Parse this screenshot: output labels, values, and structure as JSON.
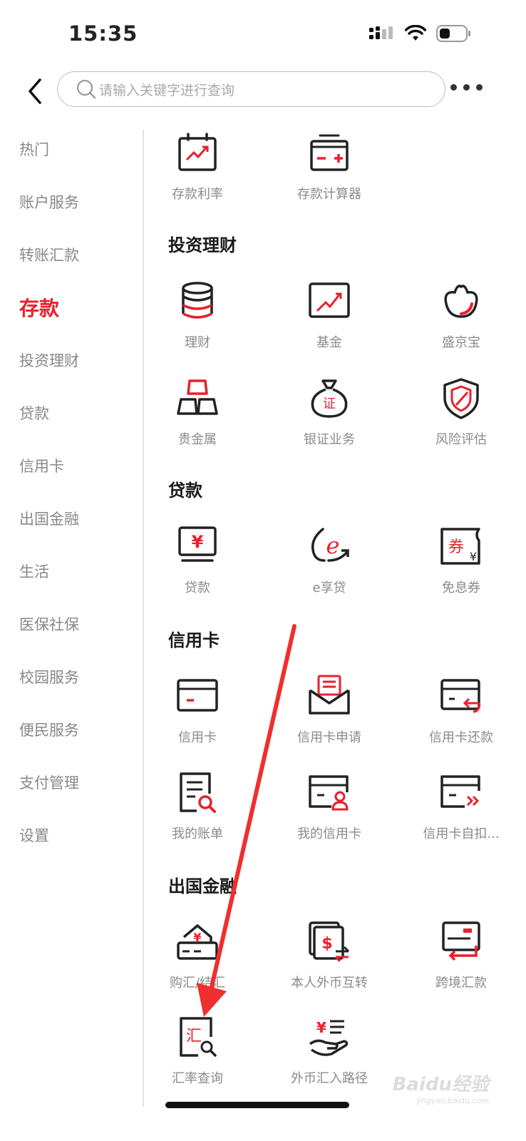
{
  "status": {
    "time": "15:35"
  },
  "search": {
    "placeholder": "请输入关键字进行查询"
  },
  "sidebar": {
    "items": [
      {
        "label": "热门"
      },
      {
        "label": "账户服务"
      },
      {
        "label": "转账汇款"
      },
      {
        "label": "存款",
        "active": true
      },
      {
        "label": "投资理财"
      },
      {
        "label": "贷款"
      },
      {
        "label": "信用卡"
      },
      {
        "label": "出国金融"
      },
      {
        "label": "生活"
      },
      {
        "label": "医保社保"
      },
      {
        "label": "校园服务"
      },
      {
        "label": "便民服务"
      },
      {
        "label": "支付管理"
      },
      {
        "label": "设置"
      }
    ]
  },
  "sections": {
    "deposit": {
      "items": [
        {
          "label": "存款利率",
          "icon": "deposit-rate-icon"
        },
        {
          "label": "存款计算器",
          "icon": "calculator-icon"
        }
      ]
    },
    "invest": {
      "title": "投资理财",
      "items": [
        {
          "label": "理财",
          "icon": "coin-stack-icon"
        },
        {
          "label": "基金",
          "icon": "fund-chart-icon"
        },
        {
          "label": "盛京宝",
          "icon": "treasure-icon"
        },
        {
          "label": "贵金属",
          "icon": "gold-bars-icon"
        },
        {
          "label": "银证业务",
          "icon": "securities-bag-icon"
        },
        {
          "label": "风险评估",
          "icon": "shield-icon"
        }
      ]
    },
    "loan": {
      "title": "贷款",
      "items": [
        {
          "label": "贷款",
          "icon": "loan-screen-icon"
        },
        {
          "label": "e享贷",
          "icon": "e-loan-icon"
        },
        {
          "label": "免息券",
          "icon": "coupon-icon"
        }
      ]
    },
    "credit": {
      "title": "信用卡",
      "items": [
        {
          "label": "信用卡",
          "icon": "credit-card-icon"
        },
        {
          "label": "信用卡申请",
          "icon": "envelope-icon"
        },
        {
          "label": "信用卡还款",
          "icon": "card-repay-icon"
        },
        {
          "label": "我的账单",
          "icon": "bill-search-icon"
        },
        {
          "label": "我的信用卡",
          "icon": "card-user-icon"
        },
        {
          "label": "信用卡自扣...",
          "icon": "card-auto-icon"
        }
      ]
    },
    "abroad": {
      "title": "出国金融",
      "items": [
        {
          "label": "购汇/结汇",
          "icon": "exchange-house-icon"
        },
        {
          "label": "本人外币互转",
          "icon": "currency-transfer-icon"
        },
        {
          "label": "跨境汇款",
          "icon": "cross-border-icon"
        },
        {
          "label": "汇率查询",
          "icon": "rate-search-icon"
        },
        {
          "label": "外币汇入路径",
          "icon": "inbound-path-icon"
        }
      ]
    }
  },
  "watermark": {
    "text": "Baidu经验",
    "sub": "jingyan.baidu.com"
  },
  "colors": {
    "accent": "#e8202d",
    "icon_dark": "#222222"
  }
}
